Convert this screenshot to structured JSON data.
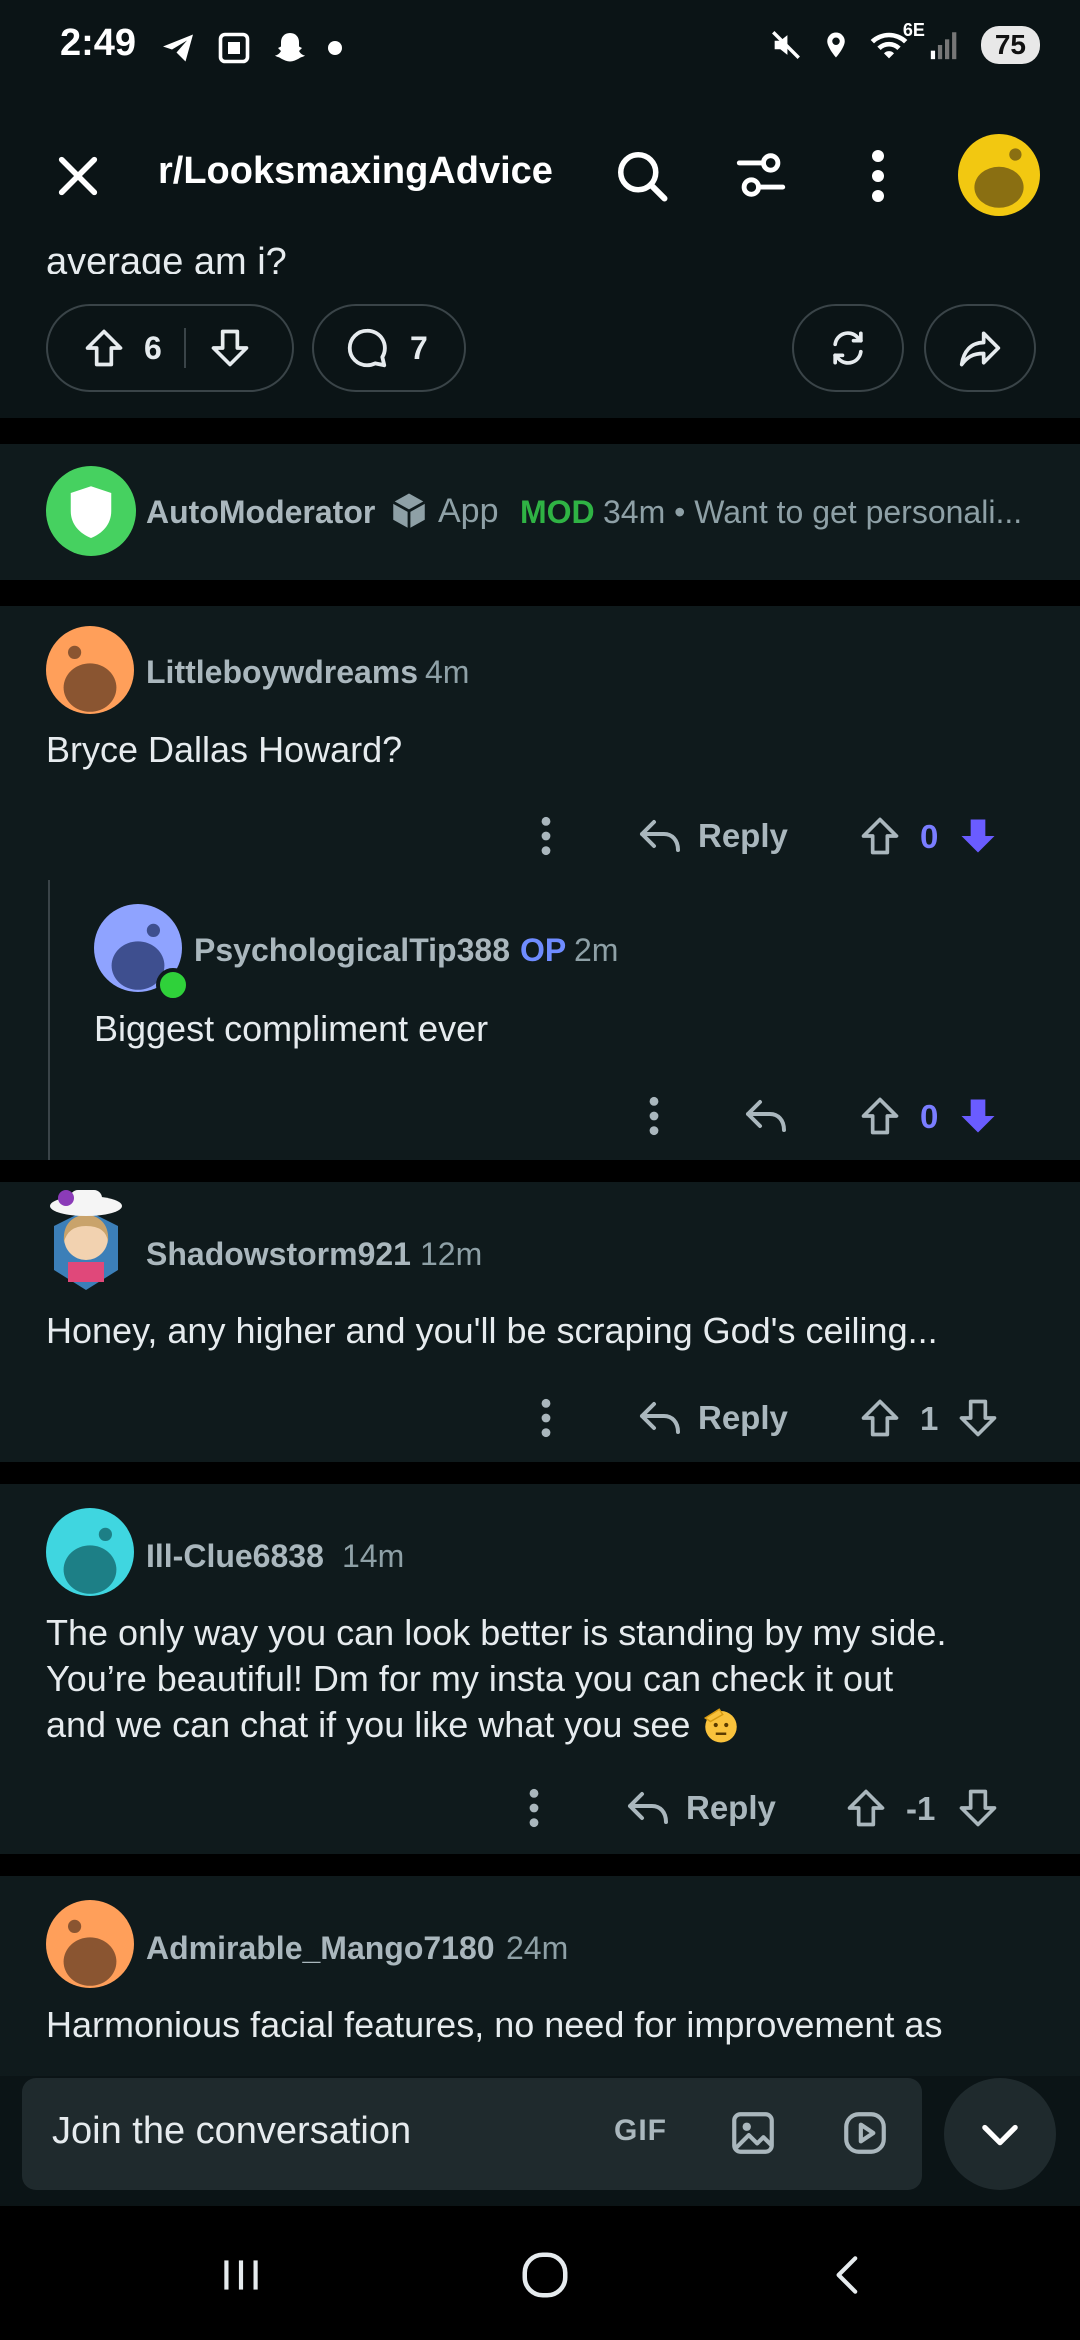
{
  "status_bar": {
    "time": "2:49",
    "network": "6E",
    "battery": "75"
  },
  "header": {
    "subreddit": "r/LooksmaxingAdvice"
  },
  "post": {
    "title_tail": "average am i?",
    "upvotes": "6",
    "comments": "7"
  },
  "automod": {
    "username": "AutoModerator",
    "app_label": "App",
    "mod_label": "MOD",
    "meta": "34m • Want to get personali..."
  },
  "comments": [
    {
      "username": "Littleboywdreams",
      "time": "4m",
      "text": "Bryce Dallas Howard?",
      "reply_label": "Reply",
      "score": "0"
    },
    {
      "username": "PsychologicalTip388",
      "op_label": "OP",
      "time": "2m",
      "text": "Biggest compliment ever",
      "score": "0"
    },
    {
      "username": "Shadowstorm921",
      "time": "12m",
      "text": "Honey, any higher and you'll be scraping God's ceiling...",
      "reply_label": "Reply",
      "score": "1"
    },
    {
      "username": "Ill-Clue6838",
      "time": "14m",
      "text_line1": "The only way you can look better is standing by my side.",
      "text_line2": "You’re beautiful! Dm for my insta you can check it out",
      "text_line3": "and we can chat if you like what you see",
      "reply_label": "Reply",
      "score": "-1"
    },
    {
      "username": "Admirable_Mango7180",
      "time": "24m",
      "text": "Harmonious facial features, no need for improvement as"
    }
  ],
  "composer": {
    "placeholder": "Join the conversation",
    "gif_label": "GIF"
  },
  "colors": {
    "background": "#0b1416",
    "accent": "#7a7dff",
    "mod_green": "#2fb344"
  }
}
